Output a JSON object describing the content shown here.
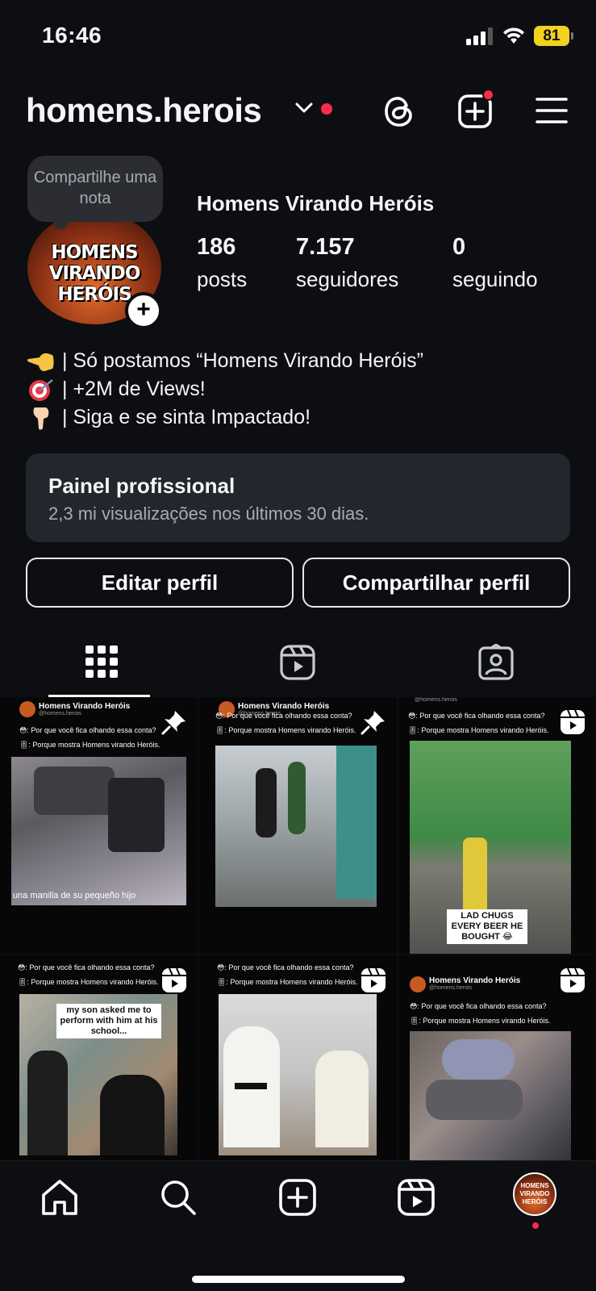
{
  "status_bar": {
    "time": "16:46",
    "battery": "81"
  },
  "header": {
    "username": "homens.herois"
  },
  "profile": {
    "note_placeholder": "Compartilhe uma nota",
    "avatar_text": "HOMENS VIRANDO HERÓIS",
    "display_name": "Homens Virando Heróis",
    "stats": [
      {
        "value": "186",
        "label": "posts"
      },
      {
        "value": "7.157",
        "label": "seguidores"
      },
      {
        "value": "0",
        "label": "seguindo"
      }
    ],
    "bio": [
      {
        "icon": "backhand-pointing-left-emoji",
        "text": "| Só postamos “Homens Virando Heróis”"
      },
      {
        "icon": "direct-hit-target-emoji",
        "text": "| +2M de Views!"
      },
      {
        "icon": "backhand-pointing-down-emoji",
        "text": "| Siga e se sinta Impactado!"
      }
    ]
  },
  "panel": {
    "title": "Painel profissional",
    "subtitle": "2,3 mi visualizações nos últimos 30 dias."
  },
  "buttons": {
    "edit": "Editar perfil",
    "share": "Compartilhar perfil"
  },
  "tabs": [
    "grid-icon",
    "reels-icon",
    "tagged-icon"
  ],
  "grid": [
    {
      "header": "Homens Virando Heróis",
      "handle": "@homens.herois",
      "line1": "😳: Por que você fica olhando essa conta?",
      "line2": "🎚: Porque mostra Homens virando Heróis.",
      "caption": "una manilla de su pequeño hijo",
      "badge": "pin-icon"
    },
    {
      "header": "Homens Virando Heróis",
      "handle": "@homens.herois",
      "line1": "😳: Por que você fica olhando essa conta?",
      "line2": "🎚: Porque mostra Homens virando Heróis.",
      "caption": "",
      "badge": "pin-icon"
    },
    {
      "header": "",
      "handle": "@homens.herois",
      "line1": "😳: Por que você fica olhando essa conta?",
      "line2": "🎚: Porque mostra Homens virando Heróis.",
      "caption": "LAD CHUGS EVERY BEER HE BOUGHT 😂",
      "badge": "reel-icon"
    },
    {
      "header": "",
      "handle": "@homens.herois",
      "line1": "😳: Por que você fica olhando essa conta?",
      "line2": "🎚: Porque mostra Homens virando Heróis.",
      "caption": "my son asked me to perform with him at his school...",
      "badge": "reel-icon"
    },
    {
      "header": "",
      "handle": "",
      "line1": "😳: Por que você fica olhando essa conta?",
      "line2": "🎚: Porque mostra Homens virando Heróis.",
      "caption": "",
      "badge": "reel-icon"
    },
    {
      "header": "Homens Virando Heróis",
      "handle": "@homens.herois",
      "line1": "😳: Por que você fica olhando essa conta?",
      "line2": "🎚: Porque mostra Homens virando Heróis.",
      "caption": "",
      "badge": "reel-icon"
    }
  ],
  "bottom_nav": [
    "home-icon",
    "search-icon",
    "create-icon",
    "reels-icon",
    "profile-avatar"
  ],
  "colors": {
    "background": "#0c0e12",
    "panel": "#23262c",
    "notification": "#ff2a4b",
    "battery": "#f2d21d"
  }
}
